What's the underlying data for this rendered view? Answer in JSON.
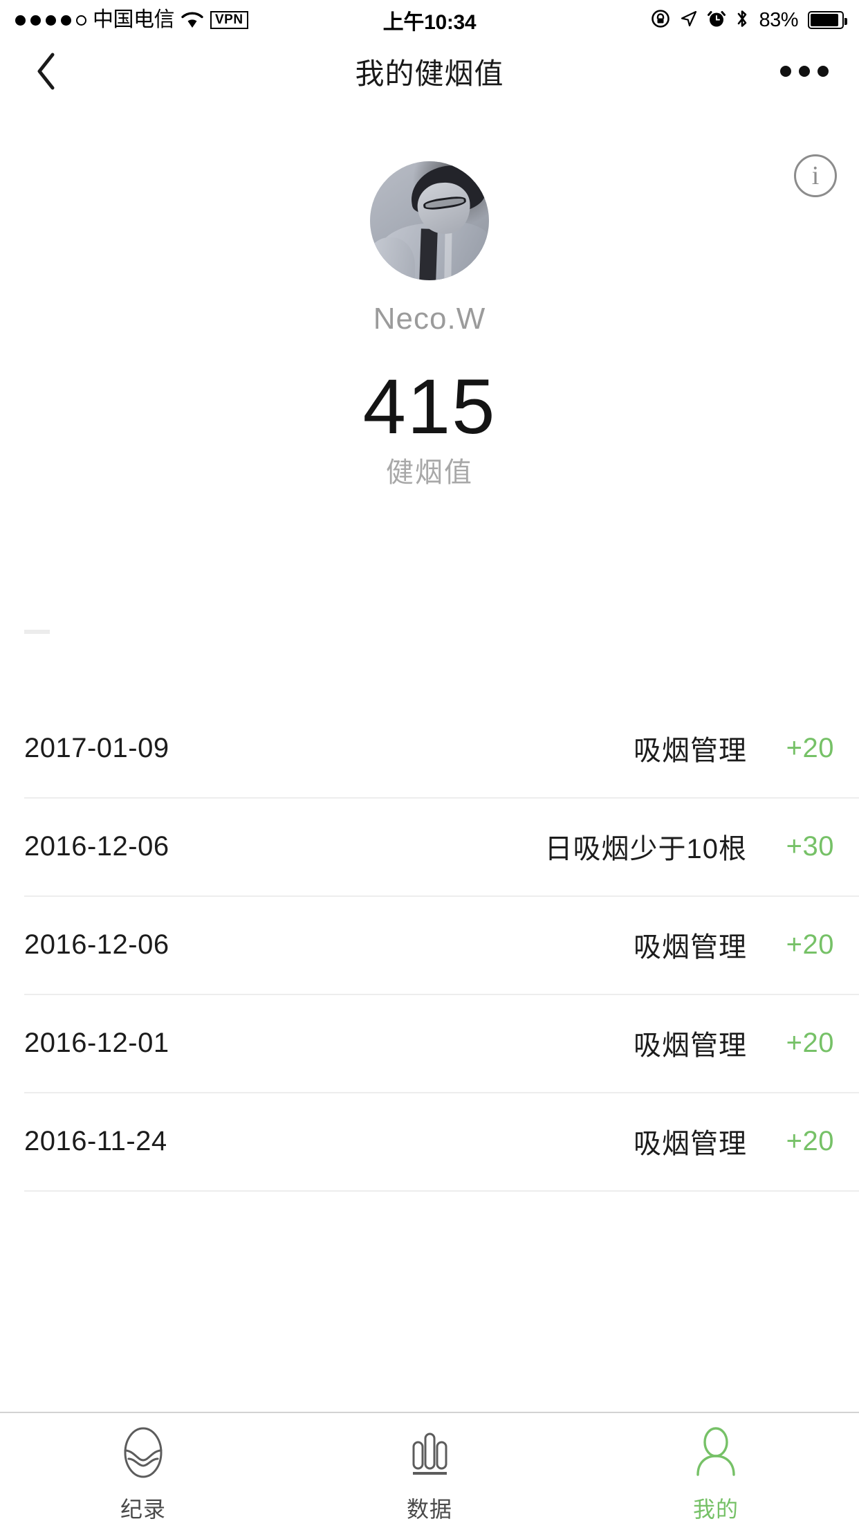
{
  "statusbar": {
    "carrier": "中国电信",
    "vpn_label": "VPN",
    "time": "上午10:34",
    "battery_text": "83%",
    "signal_dots_filled": 4,
    "signal_dots_total": 5,
    "icons": [
      "wifi-icon",
      "vpn-badge",
      "rotation-lock-icon",
      "location-arrow-icon",
      "alarm-clock-icon",
      "bluetooth-icon",
      "battery-icon"
    ]
  },
  "navbar": {
    "back_icon": "chevron-left-icon",
    "title": "我的健烟值",
    "more_icon": "more-dots-icon"
  },
  "hero": {
    "info_icon_label": "i",
    "username": "Neco.W",
    "score": "415",
    "score_label": "健烟值"
  },
  "list": {
    "rows": [
      {
        "date": "2017-01-09",
        "title": "吸烟管理",
        "points": "+20"
      },
      {
        "date": "2016-12-06",
        "title": "日吸烟少于10根",
        "points": "+30"
      },
      {
        "date": "2016-12-06",
        "title": "吸烟管理",
        "points": "+20"
      },
      {
        "date": "2016-12-01",
        "title": "吸烟管理",
        "points": "+20"
      },
      {
        "date": "2016-11-24",
        "title": "吸烟管理",
        "points": "+20"
      }
    ]
  },
  "tabbar": {
    "tabs": [
      {
        "label": "纪录",
        "icon": "leaf-record-icon",
        "active": false
      },
      {
        "label": "数据",
        "icon": "bar-chart-icon",
        "active": false
      },
      {
        "label": "我的",
        "icon": "person-icon",
        "active": true
      }
    ]
  },
  "colors": {
    "accent_green": "#76c167",
    "text_primary": "#1c1c1c",
    "text_muted": "#9b9b9b",
    "separator": "#ededed"
  }
}
